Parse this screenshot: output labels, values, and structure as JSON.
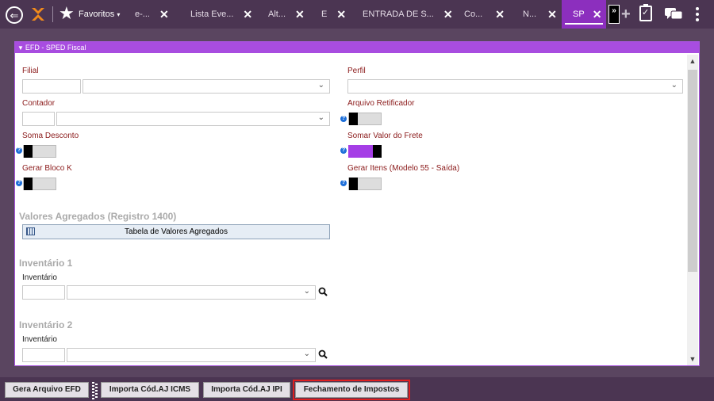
{
  "topbar": {
    "favorites_label": "Favoritos",
    "tabs": [
      {
        "label": "e-..."
      },
      {
        "label": "Lista Eve..."
      },
      {
        "label": "Alt..."
      },
      {
        "label": "E"
      },
      {
        "label": "ENTRADA DE S..."
      },
      {
        "label": "Co..."
      },
      {
        "label": "N..."
      },
      {
        "label": "SP"
      }
    ],
    "more_label": "»"
  },
  "panel": {
    "title": "EFD - SPED Fiscal",
    "filial_label": "Filial",
    "perfil_label": "Perfil",
    "contador_label": "Contador",
    "arquivo_retificador_label": "Arquivo Retificador",
    "soma_desconto_label": "Soma Desconto",
    "somar_valor_frete_label": "Somar Valor do Frete",
    "gerar_bloco_k_label": "Gerar Bloco K",
    "gerar_itens_label": "Gerar Itens (Modelo 55 - Saída)",
    "valores_agregados_title": "Valores Agregados (Registro 1400)",
    "tabela_valores_label": "Tabela de Valores Agregados",
    "inventario1_title": "Inventário 1",
    "inventario1_label": "Inventário",
    "inventario2_title": "Inventário 2",
    "inventario2_label": "Inventário",
    "toggles": {
      "arquivo_retificador": false,
      "soma_desconto": false,
      "somar_valor_frete": true,
      "gerar_bloco_k": false,
      "gerar_itens": false
    }
  },
  "bottombar": {
    "gera_arquivo": "Gera Arquivo EFD",
    "importa_icms": "Importa Cód.AJ ICMS",
    "importa_ipi": "Importa Cód.AJ IPI",
    "fechamento": "Fechamento de Impostos"
  },
  "colors": {
    "accent": "#a84de0",
    "topbar": "#4b3552",
    "label": "#8b1a1a",
    "highlight": "#e02020"
  }
}
